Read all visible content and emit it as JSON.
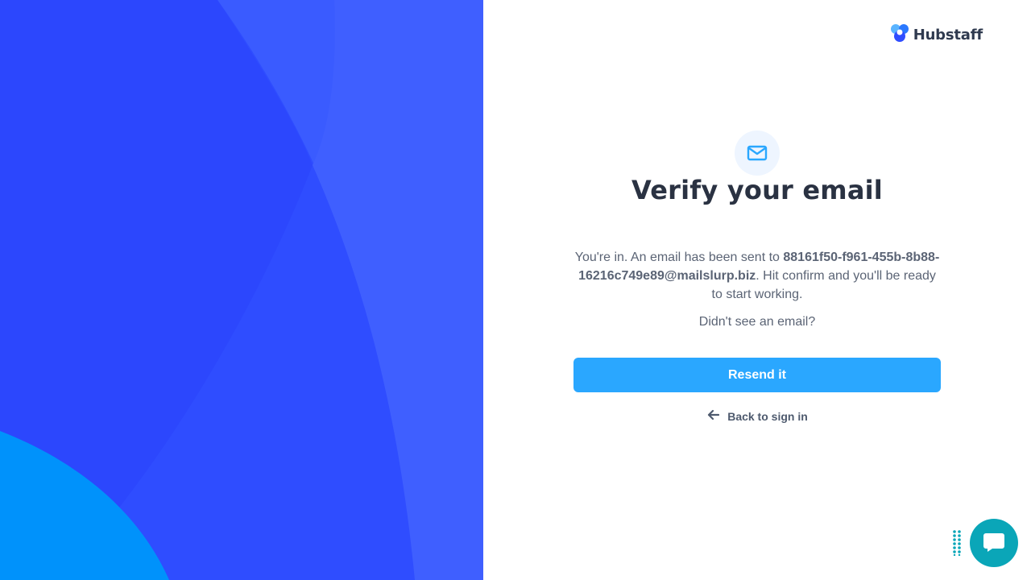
{
  "brand": {
    "name": "Hubstaff"
  },
  "icons": {
    "logo": "hubstaff-logo-icon",
    "mail": "envelope-icon",
    "back": "arrow-left-icon",
    "chat": "chat-bubble-icon",
    "drag": "drag-handle-icon"
  },
  "verify": {
    "title": "Verify your email",
    "desc_prefix": "You're in. An email has been sent to ",
    "email": "88161f50-f961-455b-8b88-16216c749e89@mailslurp.biz",
    "desc_suffix": ". Hit confirm and you'll be ready to start working.",
    "didnt_see": "Didn't see an email?",
    "resend_label": "Resend it",
    "back_label": "Back to sign in"
  },
  "colors": {
    "left_bg": "#2f4dff",
    "accent": "#2aa7ff",
    "chat": "#0aa6b8",
    "heading": "#2a3242",
    "body_text": "#5b6475"
  }
}
